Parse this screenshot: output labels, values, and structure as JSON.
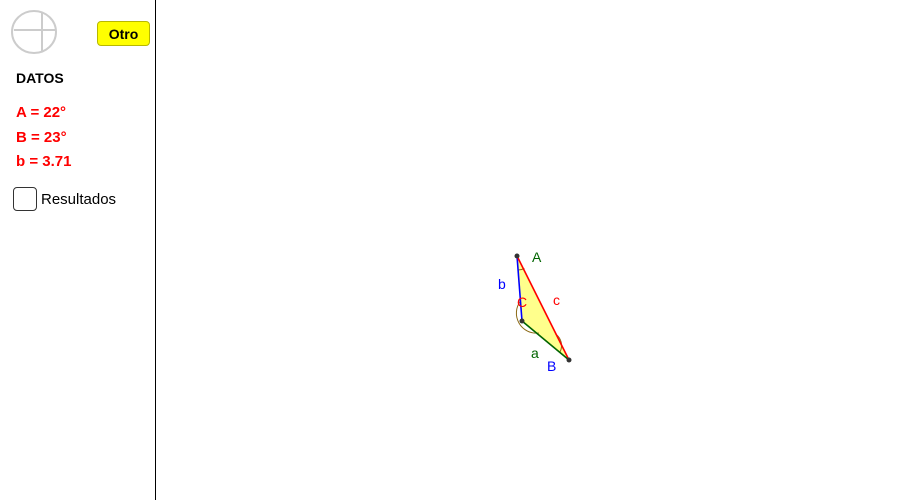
{
  "toolbar": {
    "otro_label": "Otro"
  },
  "logo": {
    "icon": "geogebra-logo-icon"
  },
  "datos": {
    "title": "DATOS",
    "line_A": "A = 22°",
    "line_B": "B = 23°",
    "line_b": "b = 3.71"
  },
  "results": {
    "label": "Resultados",
    "checked": false
  },
  "figure": {
    "vertex_labels": {
      "A": "A",
      "B": "B",
      "C": "C"
    },
    "side_labels": {
      "a": "a",
      "b": "b",
      "c": "c"
    },
    "colors": {
      "fill": "#ffff66",
      "side_a": "#006400",
      "side_b": "#0000ff",
      "side_c": "#ff0000",
      "label_A": "#006400",
      "label_B": "#0000ff",
      "label_C": "#ff0000"
    }
  }
}
